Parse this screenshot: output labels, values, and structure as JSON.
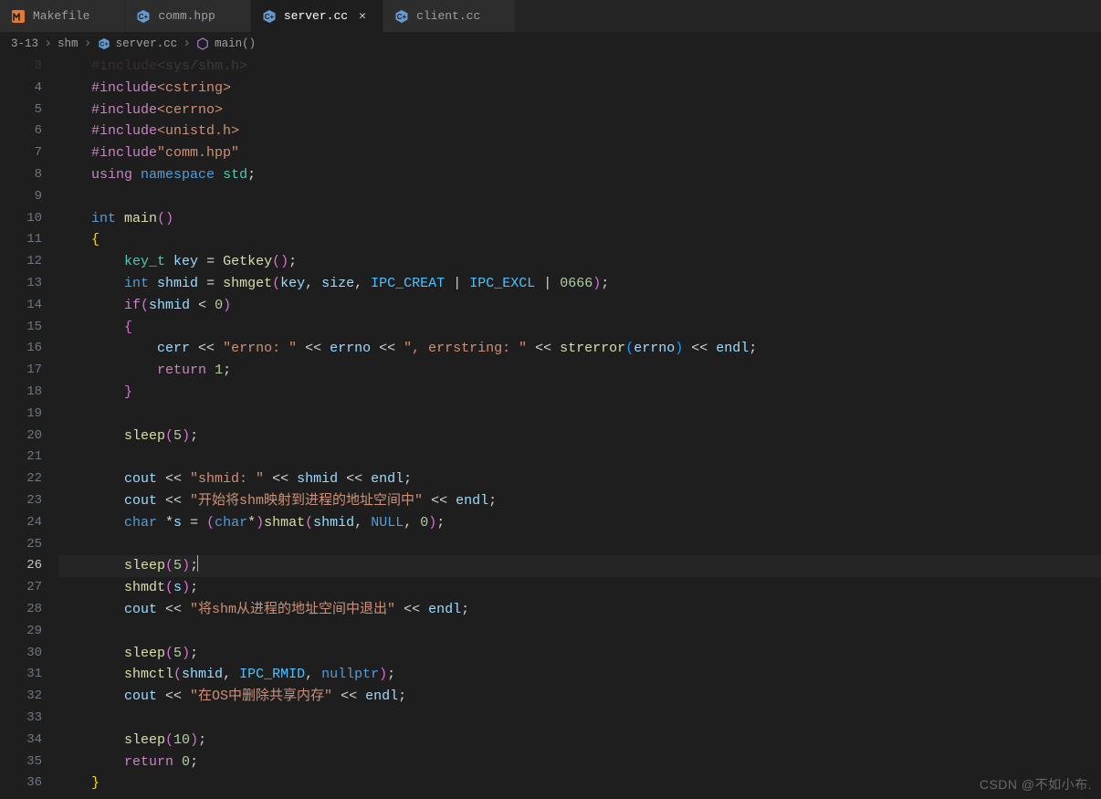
{
  "tabs": [
    {
      "label": "Makefile",
      "icon": "makefile",
      "modified": false,
      "active": false
    },
    {
      "label": "comm.hpp",
      "icon": "cpp",
      "modified": false,
      "active": false
    },
    {
      "label": "server.cc",
      "icon": "cpp",
      "modified": false,
      "active": true
    },
    {
      "label": "client.cc",
      "icon": "cpp",
      "modified": false,
      "active": false
    }
  ],
  "breadcrumbs": {
    "path1": "3-13",
    "path2": "shm",
    "file": "server.cc",
    "symbol": "main()"
  },
  "editor": {
    "first_line_no": 3,
    "active_line_no": 26,
    "lines": [
      {
        "n": 3,
        "tokens": [
          [
            "c-op",
            "    "
          ],
          [
            "c-pre",
            "#include"
          ],
          [
            "c-op",
            "<sys/shm.h>"
          ]
        ],
        "dim": true
      },
      {
        "n": 4,
        "tokens": [
          [
            "c-op",
            "    "
          ],
          [
            "c-pre",
            "#include"
          ],
          [
            "c-str",
            "<cstring>"
          ]
        ]
      },
      {
        "n": 5,
        "tokens": [
          [
            "c-op",
            "    "
          ],
          [
            "c-pre",
            "#include"
          ],
          [
            "c-str",
            "<cerrno>"
          ]
        ]
      },
      {
        "n": 6,
        "tokens": [
          [
            "c-op",
            "    "
          ],
          [
            "c-pre",
            "#include"
          ],
          [
            "c-str",
            "<unistd.h>"
          ]
        ]
      },
      {
        "n": 7,
        "tokens": [
          [
            "c-op",
            "    "
          ],
          [
            "c-pre",
            "#include"
          ],
          [
            "c-str",
            "\"comm.hpp\""
          ]
        ]
      },
      {
        "n": 8,
        "tokens": [
          [
            "c-op",
            "    "
          ],
          [
            "c-kw",
            "using"
          ],
          [
            "c-op",
            " "
          ],
          [
            "c-type",
            "namespace"
          ],
          [
            "c-op",
            " "
          ],
          [
            "c-typeg",
            "std"
          ],
          [
            "c-punc",
            ";"
          ]
        ]
      },
      {
        "n": 9,
        "tokens": [
          [
            "c-op",
            ""
          ]
        ]
      },
      {
        "n": 10,
        "tokens": [
          [
            "c-op",
            "    "
          ],
          [
            "c-type",
            "int"
          ],
          [
            "c-op",
            " "
          ],
          [
            "c-fn",
            "main"
          ],
          [
            "c-paren",
            "()"
          ]
        ]
      },
      {
        "n": 11,
        "tokens": [
          [
            "c-op",
            "    "
          ],
          [
            "c-brace",
            "{"
          ]
        ]
      },
      {
        "n": 12,
        "tokens": [
          [
            "c-op",
            "        "
          ],
          [
            "c-typeg",
            "key_t"
          ],
          [
            "c-op",
            " "
          ],
          [
            "c-var",
            "key"
          ],
          [
            "c-op",
            " = "
          ],
          [
            "c-fn",
            "Getkey"
          ],
          [
            "c-paren",
            "()"
          ],
          [
            "c-punc",
            ";"
          ]
        ]
      },
      {
        "n": 13,
        "tokens": [
          [
            "c-op",
            "        "
          ],
          [
            "c-type",
            "int"
          ],
          [
            "c-op",
            " "
          ],
          [
            "c-var",
            "shmid"
          ],
          [
            "c-op",
            " = "
          ],
          [
            "c-fn",
            "shmget"
          ],
          [
            "c-paren",
            "("
          ],
          [
            "c-var",
            "key"
          ],
          [
            "c-op",
            ", "
          ],
          [
            "c-var",
            "size"
          ],
          [
            "c-op",
            ", "
          ],
          [
            "c-macro",
            "IPC_CREAT"
          ],
          [
            "c-op",
            " | "
          ],
          [
            "c-macro",
            "IPC_EXCL"
          ],
          [
            "c-op",
            " | "
          ],
          [
            "c-num",
            "0666"
          ],
          [
            "c-paren",
            ")"
          ],
          [
            "c-punc",
            ";"
          ]
        ]
      },
      {
        "n": 14,
        "tokens": [
          [
            "c-op",
            "        "
          ],
          [
            "c-kw",
            "if"
          ],
          [
            "c-paren",
            "("
          ],
          [
            "c-var",
            "shmid"
          ],
          [
            "c-op",
            " < "
          ],
          [
            "c-num",
            "0"
          ],
          [
            "c-paren",
            ")"
          ]
        ]
      },
      {
        "n": 15,
        "tokens": [
          [
            "c-op",
            "        "
          ],
          [
            "c-paren",
            "{"
          ]
        ]
      },
      {
        "n": 16,
        "tokens": [
          [
            "c-op",
            "            "
          ],
          [
            "c-var",
            "cerr"
          ],
          [
            "c-op",
            " << "
          ],
          [
            "c-str",
            "\"errno: \""
          ],
          [
            "c-op",
            " << "
          ],
          [
            "c-var",
            "errno"
          ],
          [
            "c-op",
            " << "
          ],
          [
            "c-str",
            "\", errstring: \""
          ],
          [
            "c-op",
            " << "
          ],
          [
            "c-fn",
            "strerror"
          ],
          [
            "c-brack",
            "("
          ],
          [
            "c-var",
            "errno"
          ],
          [
            "c-brack",
            ")"
          ],
          [
            "c-op",
            " << "
          ],
          [
            "c-var",
            "endl"
          ],
          [
            "c-punc",
            ";"
          ]
        ]
      },
      {
        "n": 17,
        "tokens": [
          [
            "c-op",
            "            "
          ],
          [
            "c-kw",
            "return"
          ],
          [
            "c-op",
            " "
          ],
          [
            "c-num",
            "1"
          ],
          [
            "c-punc",
            ";"
          ]
        ]
      },
      {
        "n": 18,
        "tokens": [
          [
            "c-op",
            "        "
          ],
          [
            "c-paren",
            "}"
          ]
        ]
      },
      {
        "n": 19,
        "tokens": [
          [
            "c-op",
            ""
          ]
        ]
      },
      {
        "n": 20,
        "tokens": [
          [
            "c-op",
            "        "
          ],
          [
            "c-fn",
            "sleep"
          ],
          [
            "c-paren",
            "("
          ],
          [
            "c-num",
            "5"
          ],
          [
            "c-paren",
            ")"
          ],
          [
            "c-punc",
            ";"
          ]
        ]
      },
      {
        "n": 21,
        "tokens": [
          [
            "c-op",
            ""
          ]
        ]
      },
      {
        "n": 22,
        "tokens": [
          [
            "c-op",
            "        "
          ],
          [
            "c-var",
            "cout"
          ],
          [
            "c-op",
            " << "
          ],
          [
            "c-str",
            "\"shmid: \""
          ],
          [
            "c-op",
            " << "
          ],
          [
            "c-var",
            "shmid"
          ],
          [
            "c-op",
            " << "
          ],
          [
            "c-var",
            "endl"
          ],
          [
            "c-punc",
            ";"
          ]
        ]
      },
      {
        "n": 23,
        "tokens": [
          [
            "c-op",
            "        "
          ],
          [
            "c-var",
            "cout"
          ],
          [
            "c-op",
            " << "
          ],
          [
            "c-str",
            "\"开始将shm映射到进程的地址空间中\""
          ],
          [
            "c-op",
            " << "
          ],
          [
            "c-var",
            "endl"
          ],
          [
            "c-punc",
            ";"
          ]
        ]
      },
      {
        "n": 24,
        "tokens": [
          [
            "c-op",
            "        "
          ],
          [
            "c-type",
            "char"
          ],
          [
            "c-op",
            " *"
          ],
          [
            "c-var",
            "s"
          ],
          [
            "c-op",
            " = "
          ],
          [
            "c-paren",
            "("
          ],
          [
            "c-type",
            "char"
          ],
          [
            "c-op",
            "*"
          ],
          [
            "c-paren",
            ")"
          ],
          [
            "c-fn",
            "shmat"
          ],
          [
            "c-paren",
            "("
          ],
          [
            "c-var",
            "shmid"
          ],
          [
            "c-op",
            ", "
          ],
          [
            "c-macro2",
            "NULL"
          ],
          [
            "c-op",
            ", "
          ],
          [
            "c-num",
            "0"
          ],
          [
            "c-paren",
            ")"
          ],
          [
            "c-punc",
            ";"
          ]
        ]
      },
      {
        "n": 25,
        "tokens": [
          [
            "c-op",
            ""
          ]
        ]
      },
      {
        "n": 26,
        "tokens": [
          [
            "c-op",
            "        "
          ],
          [
            "c-fn",
            "sleep"
          ],
          [
            "c-paren",
            "("
          ],
          [
            "c-num",
            "5"
          ],
          [
            "c-paren",
            ")"
          ],
          [
            "c-punc",
            ";"
          ],
          [
            "cursor",
            ""
          ]
        ]
      },
      {
        "n": 27,
        "tokens": [
          [
            "c-op",
            "        "
          ],
          [
            "c-fn",
            "shmdt"
          ],
          [
            "c-paren",
            "("
          ],
          [
            "c-var",
            "s"
          ],
          [
            "c-paren",
            ")"
          ],
          [
            "c-punc",
            ";"
          ]
        ]
      },
      {
        "n": 28,
        "tokens": [
          [
            "c-op",
            "        "
          ],
          [
            "c-var",
            "cout"
          ],
          [
            "c-op",
            " << "
          ],
          [
            "c-str",
            "\"将shm从进程的地址空间中退出\""
          ],
          [
            "c-op",
            " << "
          ],
          [
            "c-var",
            "endl"
          ],
          [
            "c-punc",
            ";"
          ]
        ]
      },
      {
        "n": 29,
        "tokens": [
          [
            "c-op",
            ""
          ]
        ]
      },
      {
        "n": 30,
        "tokens": [
          [
            "c-op",
            "        "
          ],
          [
            "c-fn",
            "sleep"
          ],
          [
            "c-paren",
            "("
          ],
          [
            "c-num",
            "5"
          ],
          [
            "c-paren",
            ")"
          ],
          [
            "c-punc",
            ";"
          ]
        ]
      },
      {
        "n": 31,
        "tokens": [
          [
            "c-op",
            "        "
          ],
          [
            "c-fn",
            "shmctl"
          ],
          [
            "c-paren",
            "("
          ],
          [
            "c-var",
            "shmid"
          ],
          [
            "c-op",
            ", "
          ],
          [
            "c-macro",
            "IPC_RMID"
          ],
          [
            "c-op",
            ", "
          ],
          [
            "c-macro2",
            "nullptr"
          ],
          [
            "c-paren",
            ")"
          ],
          [
            "c-punc",
            ";"
          ]
        ]
      },
      {
        "n": 32,
        "tokens": [
          [
            "c-op",
            "        "
          ],
          [
            "c-var",
            "cout"
          ],
          [
            "c-op",
            " << "
          ],
          [
            "c-str",
            "\"在OS中删除共享内存\""
          ],
          [
            "c-op",
            " << "
          ],
          [
            "c-var",
            "endl"
          ],
          [
            "c-punc",
            ";"
          ]
        ]
      },
      {
        "n": 33,
        "tokens": [
          [
            "c-op",
            ""
          ]
        ]
      },
      {
        "n": 34,
        "tokens": [
          [
            "c-op",
            "        "
          ],
          [
            "c-fn",
            "sleep"
          ],
          [
            "c-paren",
            "("
          ],
          [
            "c-num",
            "10"
          ],
          [
            "c-paren",
            ")"
          ],
          [
            "c-punc",
            ";"
          ]
        ]
      },
      {
        "n": 35,
        "tokens": [
          [
            "c-op",
            "        "
          ],
          [
            "c-kw",
            "return"
          ],
          [
            "c-op",
            " "
          ],
          [
            "c-num",
            "0"
          ],
          [
            "c-punc",
            ";"
          ]
        ]
      },
      {
        "n": 36,
        "tokens": [
          [
            "c-op",
            "    "
          ],
          [
            "c-brace",
            "}"
          ]
        ]
      }
    ]
  },
  "watermark": "CSDN @不如小布."
}
